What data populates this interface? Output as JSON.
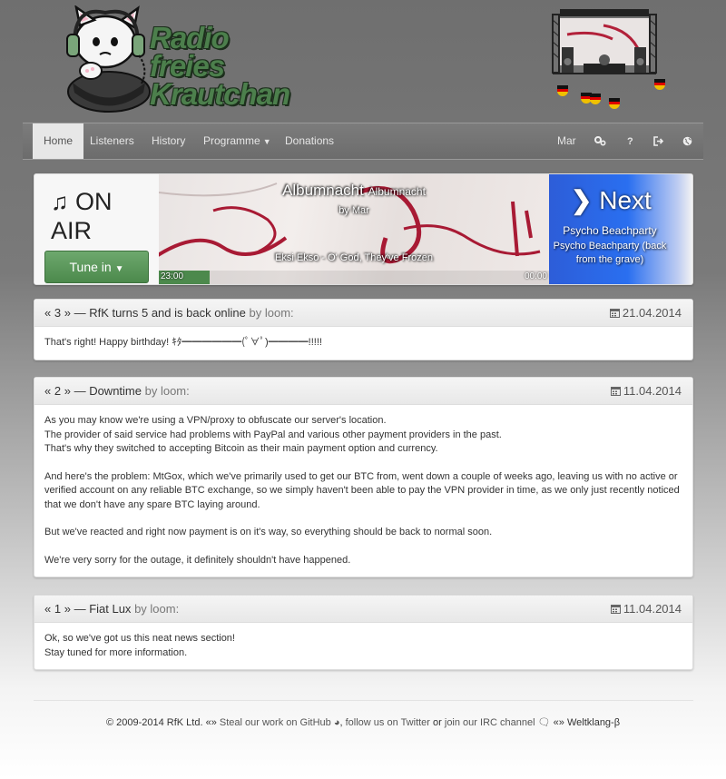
{
  "header": {
    "logo_lines": [
      "Radio",
      "freies",
      "Krautchan"
    ]
  },
  "nav": {
    "items": [
      {
        "label": "Home",
        "active": true
      },
      {
        "label": "Listeners"
      },
      {
        "label": "History"
      },
      {
        "label": "Programme",
        "dropdown": true
      },
      {
        "label": "Donations"
      }
    ],
    "user": "Mar",
    "icons": [
      "cogs-icon",
      "question-icon",
      "sign-out-icon",
      "globe-icon"
    ],
    "question_glyph": "?"
  },
  "onair": {
    "line1": "ON",
    "line2": "AIR",
    "tune_in": "Tune in",
    "now": {
      "title": "Albumnacht",
      "subtitle": "Albumnacht",
      "by": "by Mar",
      "track": "Eksi Ekso - O' God, They've Frozen",
      "elapsed": "23:00",
      "remaining": "00:00",
      "progress": 0.13
    },
    "next": {
      "label": "Next",
      "title": "Psycho Beachparty",
      "subtitle": "Psycho Beachparty (back from the grave)"
    }
  },
  "news": [
    {
      "num": "3",
      "title": "RfK turns 5 and is back online",
      "by": "by loom:",
      "date": "21.04.2014",
      "paragraphs": [
        "That's right! Happy birthday! ｷﾀ━━━━━━(ﾟ∀ﾟ)━━━━!!!!!"
      ]
    },
    {
      "num": "2",
      "title": "Downtime",
      "by": "by loom:",
      "date": "11.04.2014",
      "paragraphs": [
        "As you may know we're using a VPN/proxy to obfuscate our server's location.",
        "The provider of said service had problems with PayPal and various other payment providers in the past.",
        "That's why they switched to accepting Bitcoin as their main payment option and currency.",
        "",
        "And here's the problem: MtGox, which we've primarily used to get our BTC from, went down a couple of weeks ago, leaving us with no active or verified account on any reliable BTC exchange, so we simply haven't been able to pay the VPN provider in time, as we only just recently noticed that we don't have any spare BTC laying around.",
        "",
        "But we've reacted and right now payment is on it's way, so everything should be back to normal soon.",
        "",
        "We're very sorry for the outage, it definitely shouldn't have happened."
      ]
    },
    {
      "num": "1",
      "title": "Fiat Lux",
      "by": "by loom:",
      "date": "11.04.2014",
      "paragraphs": [
        "Ok, so we've got us this neat news section!",
        "Stay tuned for more information."
      ]
    }
  ],
  "footer": {
    "copyright": "© 2009-2014 RfK Ltd.",
    "sep1": "«»",
    "github": "Steal our work on GitHub",
    "comma": ",",
    "follow": "follow us on Twitter",
    "or": "or",
    "irc": "join our IRC channel",
    "sep2": "«»",
    "brand": "Weltklang-β"
  },
  "colors": {
    "accent": "#4c894c",
    "next_bg": "#2a6ff0"
  }
}
